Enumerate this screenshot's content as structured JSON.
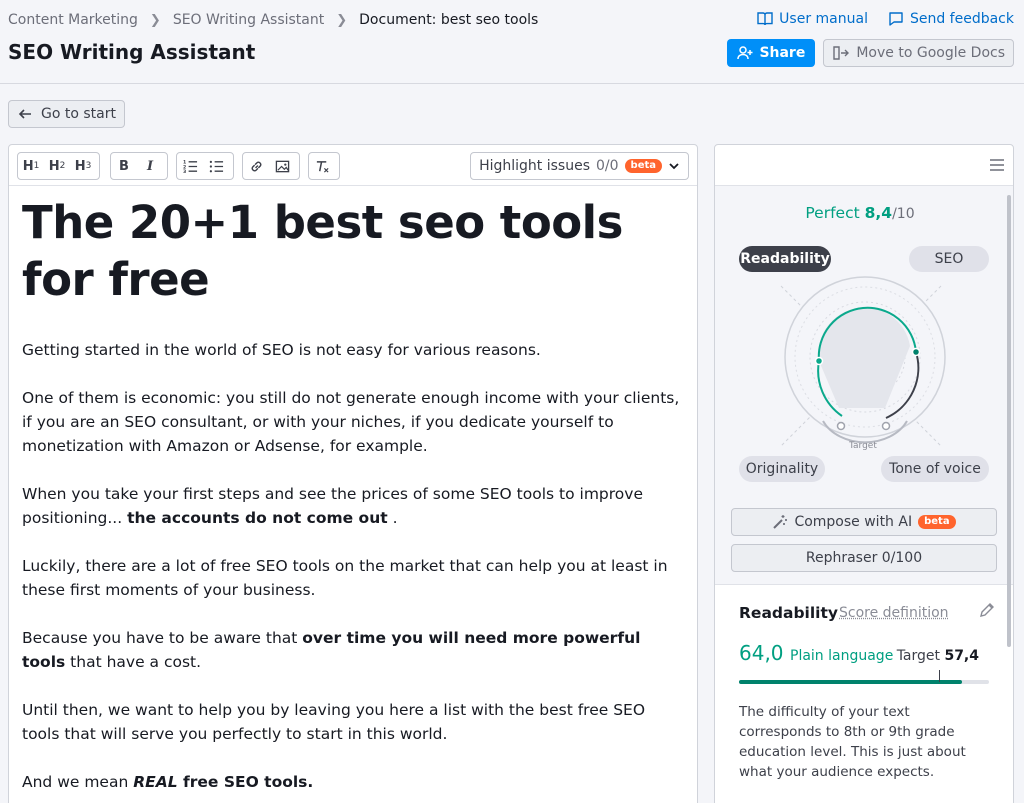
{
  "breadcrumbs": [
    "Content Marketing",
    "SEO Writing Assistant",
    "Document: best seo tools"
  ],
  "page_title": "SEO Writing Assistant",
  "top_links": {
    "manual": "User manual",
    "feedback": "Send feedback"
  },
  "actions": {
    "share": "Share",
    "gdocs": "Move to Google Docs"
  },
  "go_start": "Go to start",
  "toolbar": {
    "h1": "H",
    "h1_sub": "1",
    "h2": "H",
    "h2_sub": "2",
    "h3": "H",
    "h3_sub": "3",
    "bold": "B",
    "italic": "I",
    "highlight_label": "Highlight issues",
    "highlight_count": "0/0",
    "beta": "beta"
  },
  "document": {
    "title": "The 20+1 best seo tools for free",
    "p1": "Getting started in the world of SEO is not easy for various reasons.",
    "p2": "One of them is economic: you still do not generate enough income with your clients, if you are an SEO consultant, or with your niches, if you dedicate yourself to monetization with Amazon or Adsense, for example.",
    "p3_a": "When you take your first steps and see the prices of some SEO tools to improve positioning... ",
    "p3_b": "the accounts do not come out",
    "p3_c": " .",
    "p4": "Luckily, there are a lot of free SEO tools on the market that can help you at least in these first moments of your business.",
    "p5_a": "Because you have to be aware that ",
    "p5_b": "over time you will need more powerful tools",
    "p5_c": " that have a cost.",
    "p6": "Until then, we want to help you by leaving you here a list with the best free SEO tools that will serve you perfectly to start in this world.",
    "p7_a": "And we mean ",
    "p7_b": "REAL",
    "p7_c": " free SEO tools."
  },
  "score": {
    "label": "Perfect",
    "value": "8,4",
    "out_of": "/10"
  },
  "tabs": {
    "readability": "Readability",
    "seo": "SEO",
    "originality": "Originality",
    "tone": "Tone of voice"
  },
  "radar_target_label": "Target",
  "side_buttons": {
    "compose": "Compose with AI",
    "compose_badge": "beta",
    "rephraser": "Rephraser 0/100"
  },
  "readability": {
    "title": "Readability",
    "definition_link": "Score definition",
    "score": "64,0",
    "level": "Plain language",
    "target_label": "Target",
    "target_value": "57,4",
    "progress": 0.89,
    "target_position": 0.8,
    "description": "The difficulty of your text corresponds to 8th or 9th grade education level. This is just about what your audience expects."
  },
  "colors": {
    "accent_green": "#009f81",
    "primary_blue": "#008ff8",
    "beta_orange": "#ff642d"
  }
}
